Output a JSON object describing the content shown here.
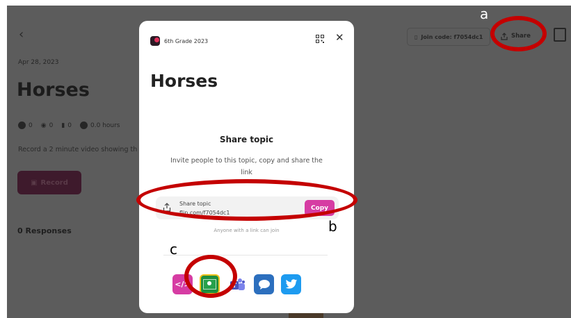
{
  "background_page": {
    "date": "Apr 28, 2023",
    "title": "Horses",
    "stats": {
      "videos": "0",
      "views": "0",
      "comments": "0",
      "hours": "0.0 hours"
    },
    "description": "Record a 2 minute video showing th",
    "record_label": "Record",
    "responses_label": "0 Responses",
    "join_code_label": "Join code: f7054dc1",
    "share_label": "Share"
  },
  "modal": {
    "group_name": "6th Grade 2023",
    "title": "Horses",
    "share_heading": "Share topic",
    "share_description": "Invite people to this topic, copy and share the link",
    "link_label": "Share topic",
    "link_url": "flip.com/f7054dc1",
    "copy_label": "Copy",
    "link_note": "Anyone with a link can join",
    "share_targets": [
      {
        "name": "embed-icon",
        "glyph": "</>"
      },
      {
        "name": "google-classroom-icon"
      },
      {
        "name": "microsoft-teams-icon"
      },
      {
        "name": "remind-icon"
      },
      {
        "name": "twitter-icon"
      }
    ]
  },
  "annotations": {
    "a": "a",
    "b": "b",
    "c": "c"
  },
  "colors": {
    "accent": "#d63ca3",
    "annotation": "#c40000"
  }
}
